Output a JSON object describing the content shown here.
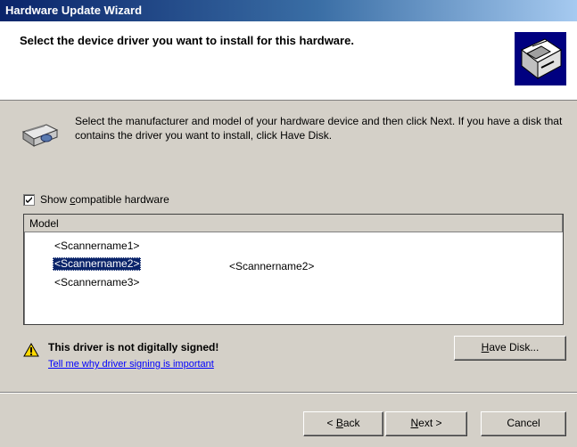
{
  "window": {
    "title": "Hardware Update Wizard"
  },
  "header": {
    "title": "Select the device driver you want to install for this hardware.",
    "icon": "hardware-wizard-icon"
  },
  "info": {
    "icon": "scanner-icon",
    "text": "Select the manufacturer and model of your hardware device and then click Next. If you have a disk that contains the driver you want to install, click Have Disk."
  },
  "checkbox": {
    "checked": true,
    "label_prefix": "Show ",
    "label_accel": "c",
    "label_rest": "ompatible hardware"
  },
  "model_list": {
    "column_header": "Model",
    "items": [
      "<Scannername1>",
      "<Scannername2>",
      "<Scannername3>"
    ],
    "selected_index": 1,
    "tooltip": "<Scannername2>"
  },
  "warning": {
    "icon": "warning-icon",
    "title": "This driver is not digitally signed!",
    "link": "Tell me why driver signing is important"
  },
  "buttons": {
    "have_disk_accel": "H",
    "have_disk_rest": "ave Disk...",
    "back_prefix": "< ",
    "back_accel": "B",
    "back_rest": "ack",
    "next_accel": "N",
    "next_rest": "ext >",
    "cancel": "Cancel"
  }
}
